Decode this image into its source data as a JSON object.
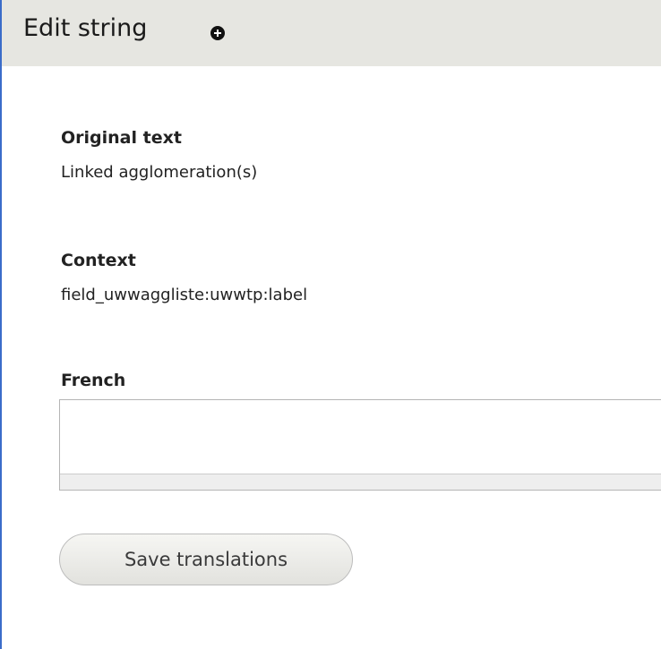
{
  "dialog": {
    "title": "Edit string",
    "title_icon": "circle-plus-icon"
  },
  "original": {
    "label": "Original text",
    "value": "Linked agglomeration(s)"
  },
  "context": {
    "label": "Context",
    "value": "field_uwwaggliste:uwwtp:label"
  },
  "translation": {
    "label": "French",
    "value": ""
  },
  "actions": {
    "save_label": "Save translations"
  },
  "colors": {
    "titlebar_bg": "#e6e6e1",
    "frame_border": "#3b6cc9"
  }
}
